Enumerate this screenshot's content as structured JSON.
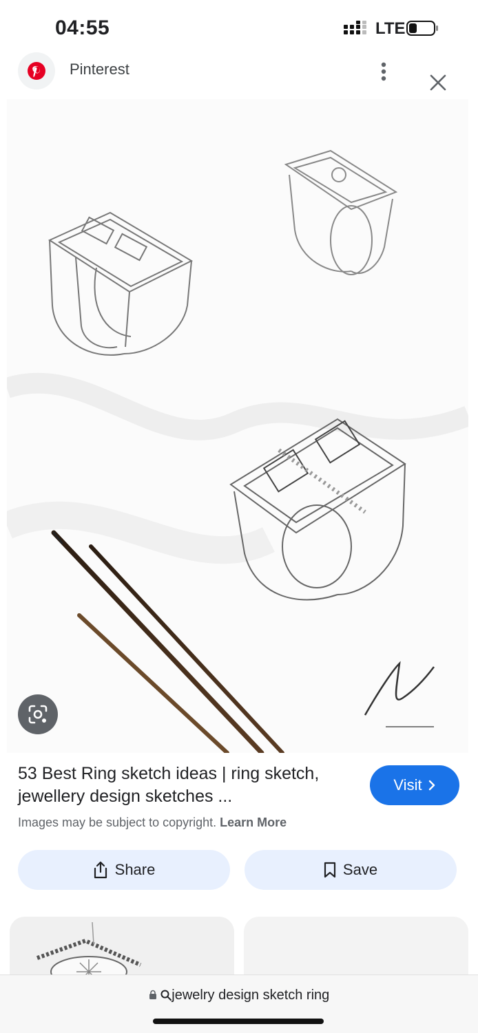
{
  "status_bar": {
    "time": "04:55",
    "network": "LTE",
    "icons": [
      "signal-icon",
      "battery-icon"
    ]
  },
  "source": {
    "name": "Pinterest",
    "icons": [
      "pinterest-logo",
      "more-vert-icon",
      "close-icon"
    ]
  },
  "image": {
    "subject": "ring-sketch-image"
  },
  "result": {
    "title": "53 Best Ring sketch ideas | ring sketch, jewellery design sketches ...",
    "visit_label": "Visit",
    "copyright_text": "Images may be subject to copyright.",
    "learn_more": "Learn More"
  },
  "actions": {
    "share_label": "Share",
    "save_label": "Save"
  },
  "url_bar": {
    "query": "jewelry design sketch ring"
  },
  "colors": {
    "accent": "#1a73e8",
    "action_bg": "#e8f0fe",
    "pinterest_red": "#e60023"
  }
}
